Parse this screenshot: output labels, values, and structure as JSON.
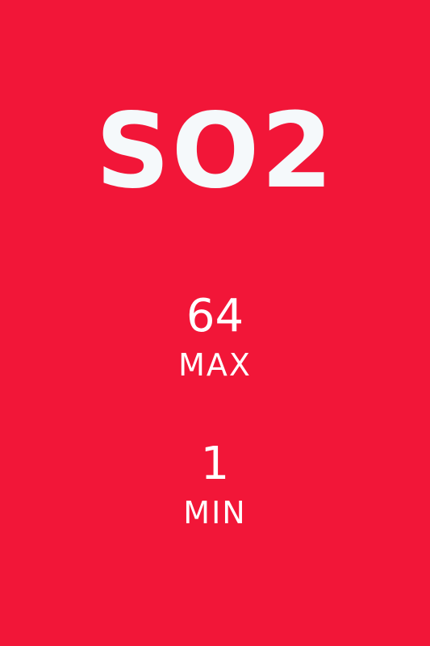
{
  "title": "SO2",
  "stats": {
    "max": {
      "value": "64",
      "label": "MAX"
    },
    "min": {
      "value": "1",
      "label": "MIN"
    }
  },
  "colors": {
    "background": "#f21638",
    "text": "#f5f9fb"
  }
}
